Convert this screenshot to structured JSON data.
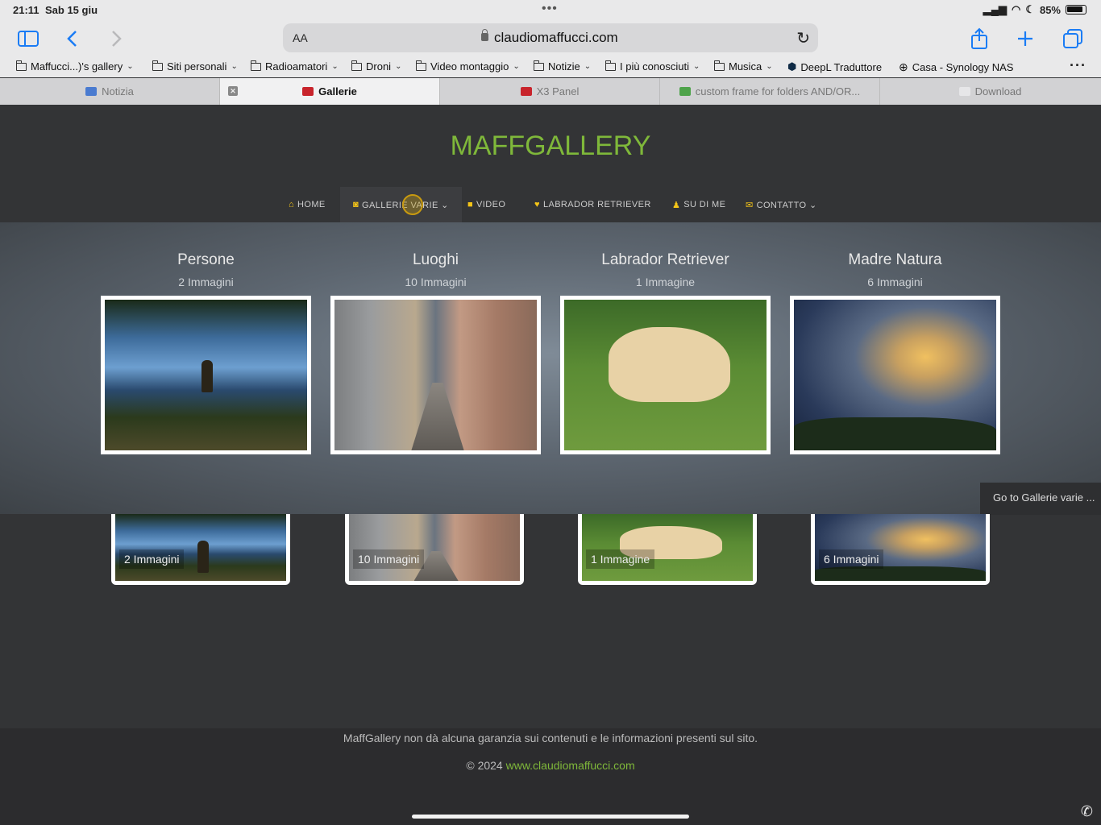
{
  "status_bar": {
    "time": "21:11",
    "date": "Sab 15 giu",
    "battery": "85%"
  },
  "browser": {
    "text_size_label": "AA",
    "url": "claudiomaffucci.com",
    "bookmarks": [
      {
        "label": "Maffucci...)'s gallery",
        "type": "folder"
      },
      {
        "label": "Siti personali",
        "type": "folder"
      },
      {
        "label": "Radioamatori",
        "type": "folder"
      },
      {
        "label": "Droni",
        "type": "folder"
      },
      {
        "label": "Video montaggio",
        "type": "folder"
      },
      {
        "label": "Notizie",
        "type": "folder"
      },
      {
        "label": "I più conosciuti",
        "type": "folder"
      },
      {
        "label": "Musica",
        "type": "folder"
      },
      {
        "label": "DeepL Traduttore",
        "type": "link"
      },
      {
        "label": "Casa - Synology NAS",
        "type": "link"
      }
    ],
    "tabs": [
      {
        "label": "Notizia",
        "active": false
      },
      {
        "label": "Gallerie",
        "active": true
      },
      {
        "label": "X3 Panel",
        "active": false
      },
      {
        "label": "custom frame for folders AND/OR...",
        "active": false
      },
      {
        "label": "Download",
        "active": false
      }
    ]
  },
  "site": {
    "logo": "MAFFGALLERY",
    "nav": [
      {
        "label": "HOME",
        "icon": "home-icon"
      },
      {
        "label": "GALLERIE VARIE ⌄",
        "icon": "camera-icon"
      },
      {
        "label": "VIDEO",
        "icon": "video-icon"
      },
      {
        "label": "LABRADOR RETRIEVER",
        "icon": "heart-icon"
      },
      {
        "label": "SU DI ME",
        "icon": "person-icon"
      },
      {
        "label": "CONTATTO ⌄",
        "icon": "envelope-icon"
      }
    ],
    "dropdown": {
      "categories": [
        {
          "title": "Persone",
          "count": "2 Immagini"
        },
        {
          "title": "Luoghi",
          "count": "10 Immagini"
        },
        {
          "title": "Labrador Retriever",
          "count": "1 Immagine"
        },
        {
          "title": "Madre Natura",
          "count": "6 Immagini"
        }
      ],
      "goto_label": "Go to Gallerie varie ..."
    },
    "gallery_cards": [
      {
        "caption": "2 Immagini"
      },
      {
        "caption": "10 Immagini"
      },
      {
        "caption": "1 Immagine"
      },
      {
        "caption": "6 Immagini"
      }
    ],
    "footer": {
      "note": "MaffGallery non dà alcuna garanzia sui contenuti e le informazioni presenti sul sito.",
      "copyright_prefix": "© 2024",
      "link_text": "www.claudiomaffucci.com"
    }
  },
  "colors": {
    "brand_green": "#7fb83a",
    "nav_icon_yellow": "#f5c518",
    "ios_blue": "#1a7cf5"
  }
}
